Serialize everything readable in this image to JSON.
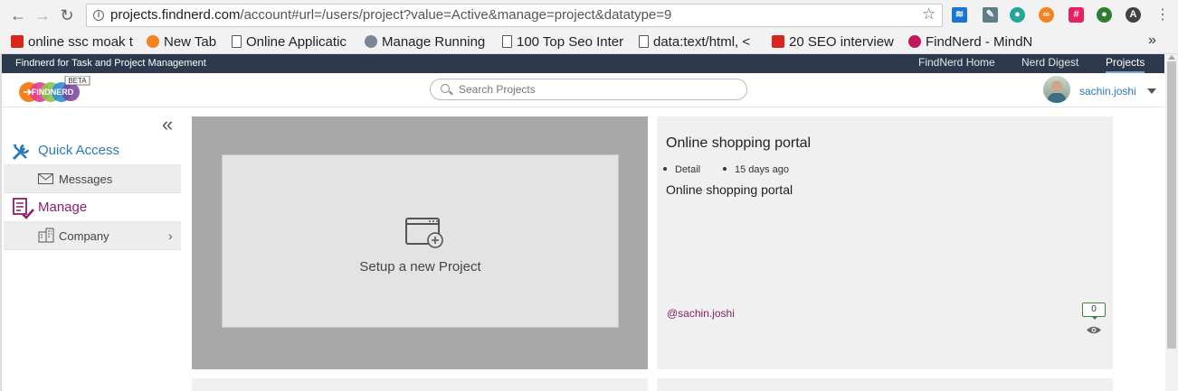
{
  "browser": {
    "url_host": "projects.findnerd.com",
    "url_path": "/account#url=/users/project?value=Active&manage=project&datatype=9",
    "bookmarks": [
      {
        "label": "online ssc moak t",
        "color": "#d9261c"
      },
      {
        "label": "New Tab",
        "color": "#f58220"
      },
      {
        "label": "Online Applicatic",
        "color": "page"
      },
      {
        "label": "Manage Running",
        "color": "#7b8794"
      },
      {
        "label": "100 Top Seo Inter",
        "color": "page"
      },
      {
        "label": "data:text/html, <",
        "color": "page"
      },
      {
        "label": "20 SEO interview",
        "color": "#d9261c"
      },
      {
        "label": "FindNerd - MindN",
        "color": "#c2185b"
      }
    ],
    "more_label": "»"
  },
  "site": {
    "tagline": "Findnerd for Task and Project Management",
    "nav": [
      "FindNerd Home",
      "Nerd Digest",
      "Projects"
    ],
    "active_nav": "Projects",
    "logo_text": "FINDNERD",
    "logo_badge": "BETA",
    "search_placeholder": "Search Projects",
    "username": "sachin.joshi"
  },
  "sidebar": {
    "collapse_label": "«",
    "quick_access": "Quick Access",
    "messages": "Messages",
    "manage": "Manage",
    "company": "Company",
    "chevron": "›"
  },
  "main": {
    "new_project_label": "Setup a new Project",
    "project": {
      "title": "Online shopping portal",
      "meta_detail": "Detail",
      "meta_time": "15 days ago",
      "description": "Online shopping portal",
      "owner": "@sachin.joshi",
      "comment_count": "0"
    }
  },
  "colors": {
    "topbar": "#2d3a4d",
    "accent_blue": "#2a7ab8",
    "manage_purple": "#8a1f6e"
  }
}
